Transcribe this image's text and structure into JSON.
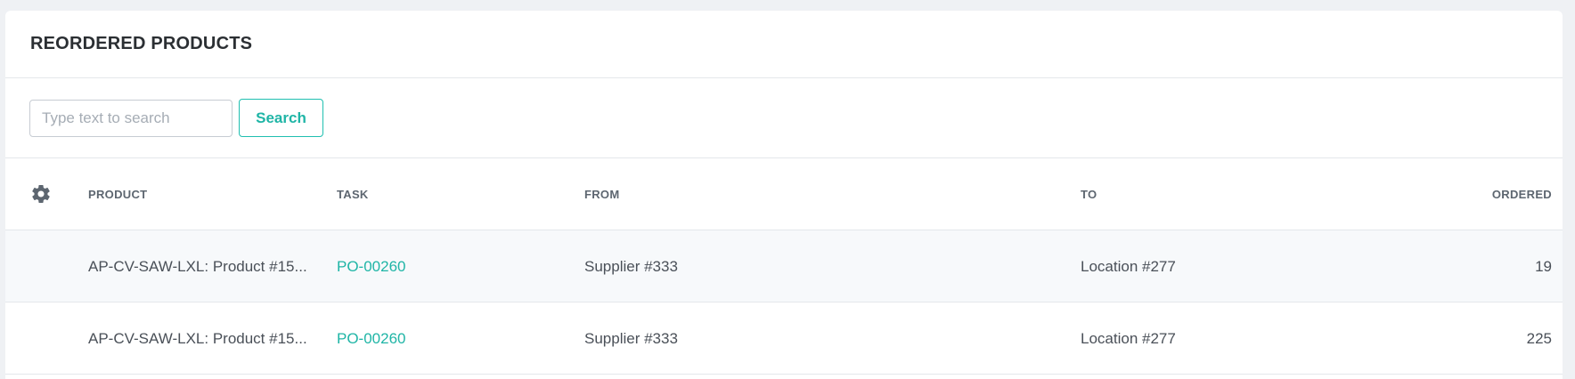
{
  "card": {
    "title": "REORDERED PRODUCTS"
  },
  "search": {
    "placeholder": "Type text to search",
    "value": "",
    "button_label": "Search"
  },
  "table": {
    "columns": {
      "product": "PRODUCT",
      "task": "TASK",
      "from": "FROM",
      "to": "TO",
      "ordered": "ORDERED"
    },
    "rows": [
      {
        "product": "AP-CV-SAW-LXL: Product #15...",
        "task": "PO-00260",
        "from": "Supplier #333",
        "to": "Location #277",
        "ordered": "19"
      },
      {
        "product": "AP-CV-SAW-LXL: Product #15...",
        "task": "PO-00260",
        "from": "Supplier #333",
        "to": "Location #277",
        "ordered": "225"
      }
    ]
  },
  "colors": {
    "accent": "#1fb5a6",
    "header_text": "#5d6670",
    "body_text": "#4a5058",
    "page_bg": "#eff1f4"
  },
  "icons": {
    "settings": "gear-icon"
  }
}
